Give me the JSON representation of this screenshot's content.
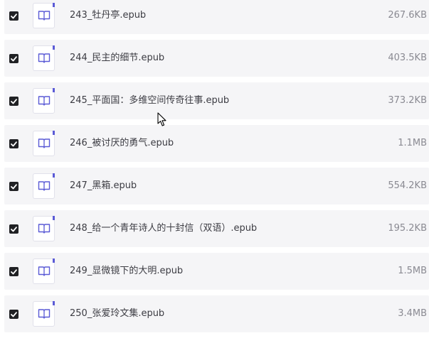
{
  "files": [
    {
      "name": "243_牡丹亭.epub",
      "size": "267.6KB",
      "checked": true
    },
    {
      "name": "244_民主的细节.epub",
      "size": "403.5KB",
      "checked": true
    },
    {
      "name": "245_平面国：多维空间传奇往事.epub",
      "size": "373.2KB",
      "checked": true
    },
    {
      "name": "246_被讨厌的勇气.epub",
      "size": "1.1MB",
      "checked": true
    },
    {
      "name": "247_黑箱.epub",
      "size": "554.2KB",
      "checked": true
    },
    {
      "name": "248_给一个青年诗人的十封信（双语）.epub",
      "size": "195.2KB",
      "checked": true
    },
    {
      "name": "249_显微镜下的大明.epub",
      "size": "1.5MB",
      "checked": true
    },
    {
      "name": "250_张爱玲文集.epub",
      "size": "3.4MB",
      "checked": true
    }
  ],
  "icons": {
    "file": "book-icon",
    "checkbox": "checkmark-icon",
    "pointer": "mouse-cursor-icon"
  },
  "colors": {
    "accent": "#5b5bd6",
    "row_background": "#f5f5f7",
    "checkbox": "#202124",
    "name_text": "#3c3c43",
    "size_text": "#8a8a92"
  }
}
